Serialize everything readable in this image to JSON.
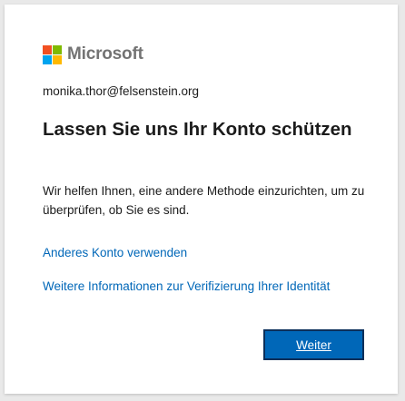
{
  "brand": {
    "name": "Microsoft",
    "logo_colors": [
      "#f25022",
      "#7fba00",
      "#00a4ef",
      "#ffb900"
    ]
  },
  "account": {
    "email": "monika.thor@felsenstein.org"
  },
  "content": {
    "title": "Lassen Sie uns Ihr Konto schützen",
    "description": "Wir helfen Ihnen, eine andere Methode einzurichten, um zu überprüfen, ob Sie es sind."
  },
  "links": {
    "other_account": "Anderes Konto verwenden",
    "more_info": "Weitere Informationen zur Verifizierung Ihrer Identität"
  },
  "actions": {
    "next_label": "Weiter"
  },
  "colors": {
    "link": "#0067b8",
    "primary_button": "#0067b8"
  }
}
